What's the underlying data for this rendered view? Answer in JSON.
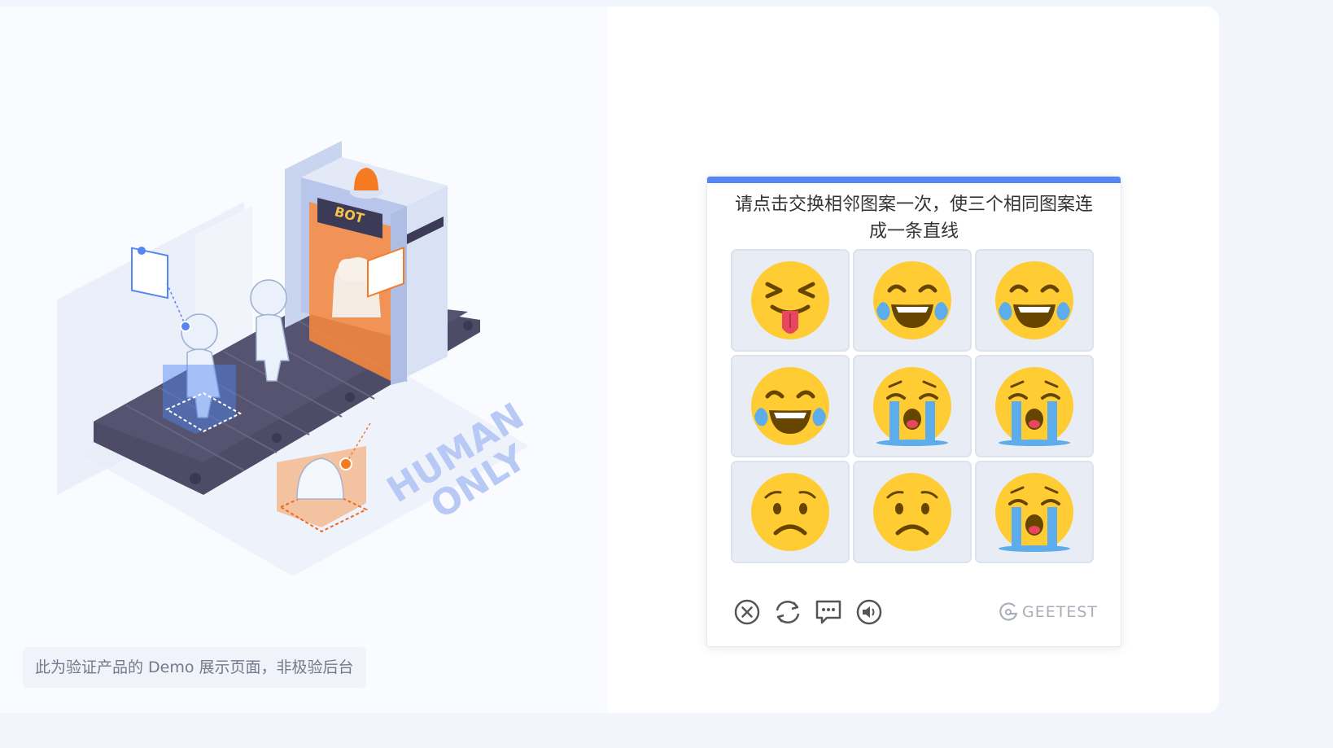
{
  "demo_note": "此为验证产品的 Demo 展示页面，非极验后台",
  "illustration": {
    "gate_label": "BOT",
    "stamp_line1": "HUMAN",
    "stamp_line2": "ONLY"
  },
  "captcha": {
    "accent_color": "#5685f5",
    "instruction": "请点击交换相邻图案一次，使三个相同图案连成一条直线",
    "tiles": [
      {
        "icon": "squinting-tongue-face"
      },
      {
        "icon": "tears-of-joy-face"
      },
      {
        "icon": "tears-of-joy-face"
      },
      {
        "icon": "tears-of-joy-face"
      },
      {
        "icon": "loudly-crying-face"
      },
      {
        "icon": "loudly-crying-face"
      },
      {
        "icon": "worried-face"
      },
      {
        "icon": "worried-face"
      },
      {
        "icon": "loudly-crying-face"
      }
    ],
    "footer_icons": [
      "close-icon",
      "refresh-icon",
      "feedback-icon",
      "audio-icon"
    ],
    "brand": "GEETEST"
  }
}
